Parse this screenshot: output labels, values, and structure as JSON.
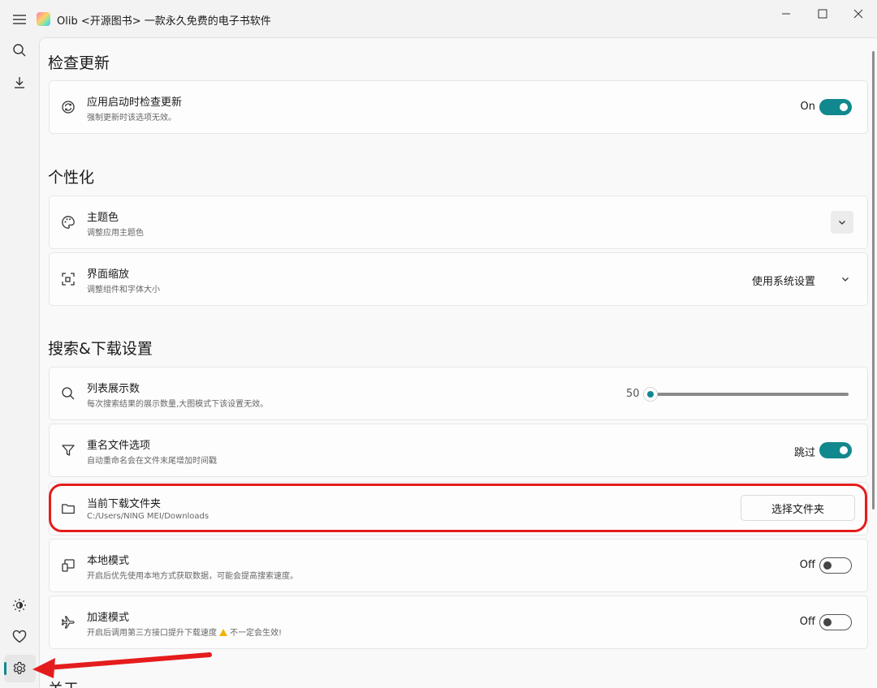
{
  "window": {
    "title": "Olib <开源图书> 一款永久免费的电子书软件"
  },
  "sections": {
    "update": {
      "title": "检查更新",
      "auto_check": {
        "title": "应用启动时检查更新",
        "subtitle": "强制更新时该选项无效。",
        "state_label": "On",
        "enabled": true
      }
    },
    "personal": {
      "title": "个性化",
      "theme": {
        "title": "主题色",
        "subtitle": "调整应用主题色"
      },
      "scale": {
        "title": "界面缩放",
        "subtitle": "调整组件和字体大小",
        "value": "使用系统设置"
      }
    },
    "search": {
      "title": "搜索&下载设置",
      "list_count": {
        "title": "列表展示数",
        "subtitle": "每次搜索结果的展示数量,大图模式下该设置无效。",
        "value": "50",
        "slider_fraction": 0.0
      },
      "rename": {
        "title": "重名文件选项",
        "subtitle": "自动重命名会在文件末尾增加时间戳",
        "state_label": "跳过",
        "enabled": true
      },
      "folder": {
        "title": "当前下载文件夹",
        "subtitle": "C:/Users/NING MEI/Downloads",
        "button": "选择文件夹"
      },
      "local": {
        "title": "本地模式",
        "subtitle": "开启后优先使用本地方式获取数据，可能会提高搜索速度。",
        "state_label": "Off",
        "enabled": false
      },
      "accel": {
        "title": "加速模式",
        "subtitle_pre": "开启后调用第三方接口提升下载速度",
        "subtitle_post": "不一定会生效!",
        "state_label": "Off",
        "enabled": false
      }
    },
    "about": {
      "title": "关于"
    }
  },
  "colors": {
    "accent": "#11888d",
    "annotation": "#e51c1c"
  }
}
